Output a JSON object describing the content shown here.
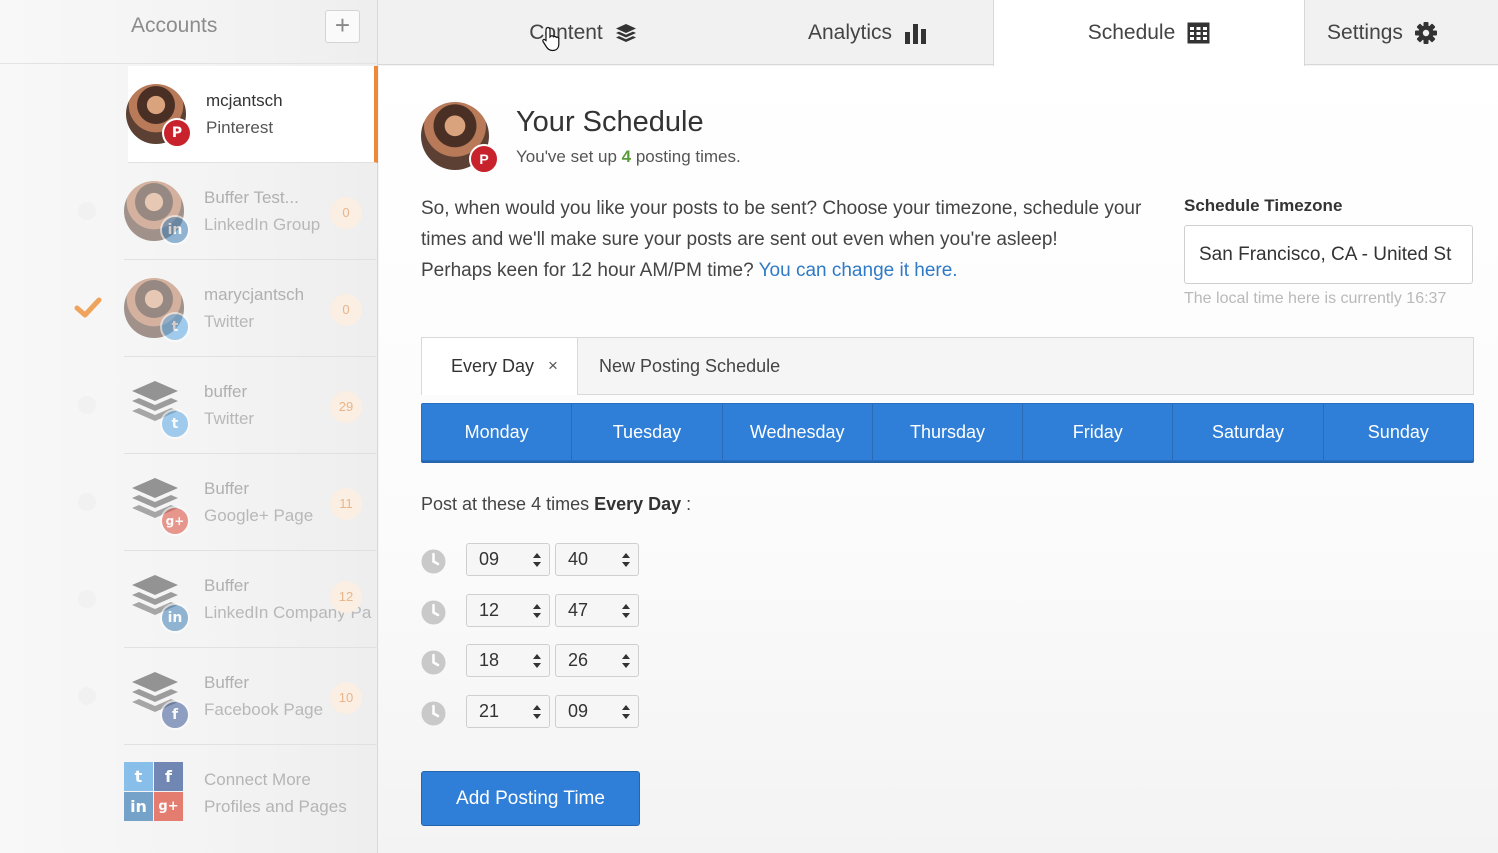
{
  "sidebar": {
    "title": "Accounts",
    "add_label": "+",
    "accounts": [
      {
        "name": "mcjantsch",
        "type": "Pinterest",
        "count": "",
        "network": "P",
        "color": "#c8232c"
      },
      {
        "name": "Buffer Test...",
        "type": "LinkedIn Group",
        "count": "0",
        "network": "in",
        "color": "#3e7fb5"
      },
      {
        "name": "marycjantsch",
        "type": "Twitter",
        "count": "0",
        "network": "t",
        "color": "#5aa9e6"
      },
      {
        "name": "buffer",
        "type": "Twitter",
        "count": "29",
        "network": "t",
        "color": "#5aa9e6"
      },
      {
        "name": "Buffer",
        "type": "Google+ Page",
        "count": "11",
        "network": "g+",
        "color": "#dd4b39"
      },
      {
        "name": "Buffer",
        "type": "LinkedIn Company Pa",
        "count": "12",
        "network": "in",
        "color": "#3e7fb5"
      },
      {
        "name": "Buffer",
        "type": "Facebook Page",
        "count": "10",
        "network": "f",
        "color": "#3b5998"
      }
    ],
    "connect_more": {
      "line1": "Connect More",
      "line2": "Profiles and Pages"
    }
  },
  "tabs": {
    "content": "Content",
    "analytics": "Analytics",
    "schedule": "Schedule",
    "settings": "Settings"
  },
  "profile": {
    "title": "Your Schedule",
    "subtitle_prefix": "You've set up ",
    "posting_count": "4",
    "subtitle_suffix": " posting times."
  },
  "intro": {
    "text": "So, when would you like your posts to be sent? Choose your timezone, schedule your times and we'll make sure your posts are sent out even when you're asleep!",
    "ampm_prefix": "Perhaps keen for 12 hour AM/PM time? ",
    "ampm_link": "You can change it here."
  },
  "timezone": {
    "label": "Schedule Timezone",
    "value": "San Francisco, CA - United St",
    "note": "The local time here is currently 16:37"
  },
  "schedule_tabs": {
    "active": "Every Day",
    "close": "×",
    "new": "New Posting Schedule"
  },
  "days": [
    "Monday",
    "Tuesday",
    "Wednesday",
    "Thursday",
    "Friday",
    "Saturday",
    "Sunday"
  ],
  "post_label": {
    "prefix": "Post at these 4 times ",
    "bold": "Every Day",
    "suffix": " :"
  },
  "times": [
    {
      "hour": "09",
      "minute": "40"
    },
    {
      "hour": "12",
      "minute": "47"
    },
    {
      "hour": "18",
      "minute": "26"
    },
    {
      "hour": "21",
      "minute": "09"
    }
  ],
  "add_time_label": "Add Posting Time"
}
